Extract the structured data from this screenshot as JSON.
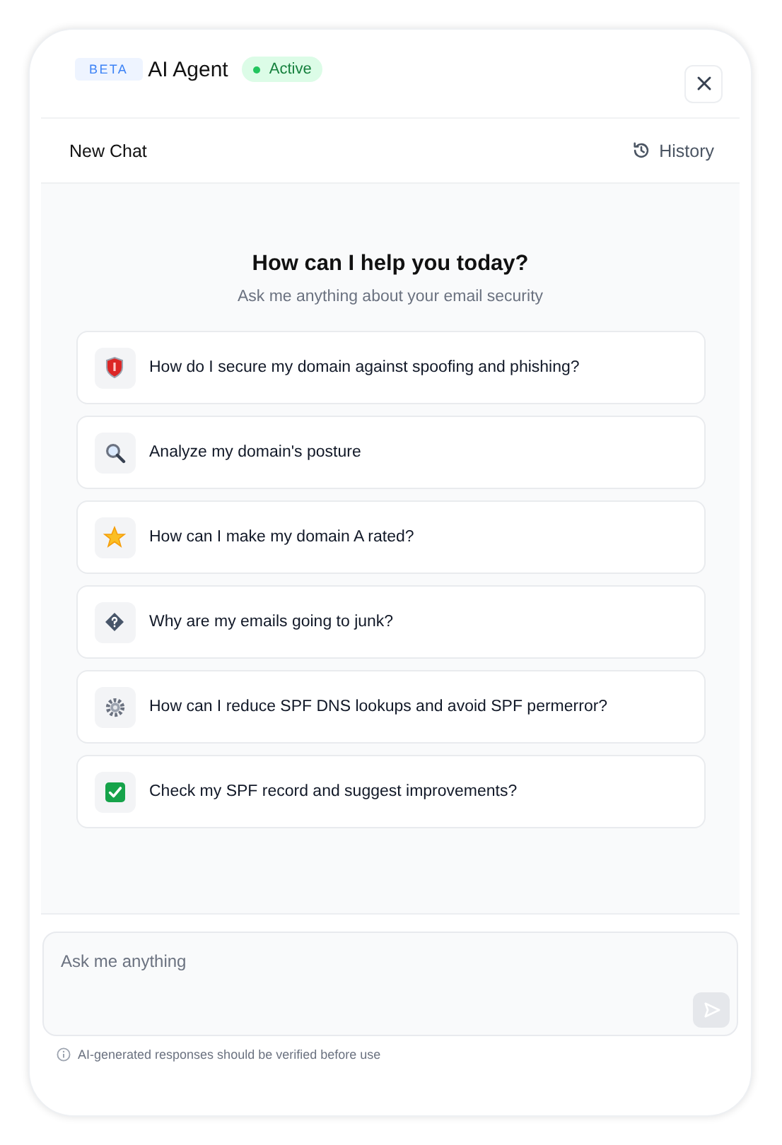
{
  "header": {
    "badge": "BETA",
    "title": "AI Agent",
    "status": {
      "label": "Active",
      "color": "#22c55e"
    }
  },
  "toolbar": {
    "new_chat": "New Chat",
    "history": "History"
  },
  "welcome": {
    "title": "How can I help you today?",
    "subtitle": "Ask me anything about your email security"
  },
  "suggestions": [
    {
      "kind": "shield",
      "text": "How do I secure my domain against spoofing and phishing?"
    },
    {
      "kind": "search",
      "text": "Analyze my domain's posture"
    },
    {
      "kind": "star",
      "text": "How can I make my domain A rated?"
    },
    {
      "kind": "question",
      "text": "Why are my emails going to junk?"
    },
    {
      "kind": "gear",
      "text": "How can I reduce SPF DNS lookups and avoid SPF permerror?"
    },
    {
      "kind": "check",
      "text": "Check my SPF record and suggest improvements?"
    }
  ],
  "composer": {
    "placeholder": "Ask me anything",
    "send_disabled": true
  },
  "disclaimer": "AI-generated responses should be verified before use"
}
